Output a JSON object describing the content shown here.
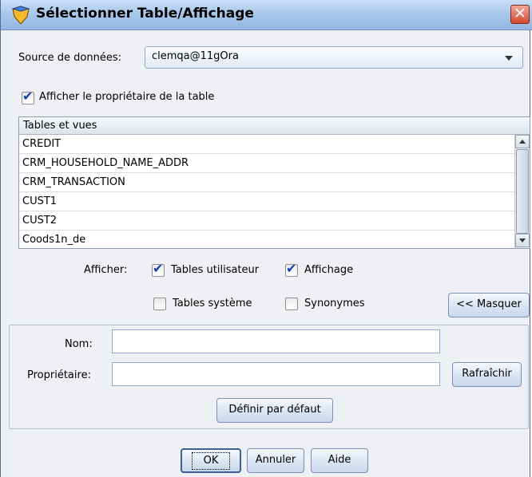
{
  "window": {
    "title": "Sélectionner Table/Affichage",
    "close_glyph": "✕"
  },
  "source": {
    "label": "Source de données:",
    "value": "clemqa@11gOra"
  },
  "show_owner": {
    "label": "Afficher le propriétaire de la table",
    "checked": true
  },
  "list": {
    "header": "Tables et vues",
    "items": [
      "CREDIT",
      "CRM_HOUSEHOLD_NAME_ADDR",
      "CRM_TRANSACTION",
      "CUST1",
      "CUST2",
      "Coods1n_de"
    ]
  },
  "display": {
    "label": "Afficher:",
    "user_tables": {
      "label": "Tables utilisateur",
      "checked": true
    },
    "views": {
      "label": "Affichage",
      "checked": true
    },
    "system_tables": {
      "label": "Tables système",
      "checked": false
    },
    "synonyms": {
      "label": "Synonymes",
      "checked": false
    },
    "hide_button": "<< Masquer"
  },
  "filter": {
    "name_label": "Nom:",
    "name_value": "",
    "owner_label": "Propriétaire:",
    "owner_value": "",
    "refresh_button": "Rafraîchir",
    "default_button": "Définir par défaut"
  },
  "footer": {
    "ok": "OK",
    "cancel": "Annuler",
    "help": "Aide"
  },
  "icons": {
    "app": "shield-icon",
    "close": "close-icon",
    "dropdown": "chevron-down-icon",
    "scroll_up": "arrow-up-icon",
    "scroll_down": "arrow-down-icon"
  },
  "colors": {
    "title_bar": "#a9c8ec",
    "close_button": "#d4482f",
    "check_mark": "#1c3fae"
  }
}
